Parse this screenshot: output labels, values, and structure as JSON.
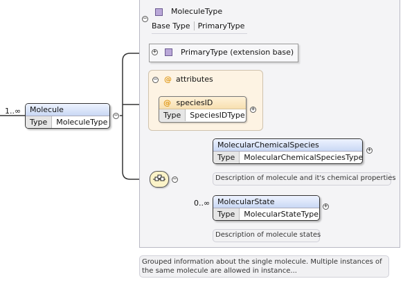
{
  "complex_type": {
    "name": "MoleculeType",
    "base_type_label": "Base Type",
    "base_type_value": "PrimaryType"
  },
  "root_element": {
    "cardinality": "1..∞",
    "name": "Molecule",
    "type_label": "Type",
    "type_value": "MoleculeType"
  },
  "extension": {
    "label": "PrimaryType (extension base)"
  },
  "attributes": {
    "title": "attributes",
    "attr_name": "speciesID",
    "type_label": "Type",
    "type_value": "SpeciesIDType"
  },
  "children": [
    {
      "name": "MolecularChemicalSpecies",
      "type_label": "Type",
      "type_value": "MolecularChemicalSpeciesType",
      "doc": "Description of molecule and it's chemical properties"
    },
    {
      "cardinality": "0..∞",
      "name": "MolecularState",
      "type_label": "Type",
      "type_value": "MolecularStateType",
      "doc": "Description of molecule states"
    }
  ],
  "annotation": "Grouped information about the single molecule. Multiple instances of the same molecule are allowed in instance...",
  "colors": {
    "element_header": "#c9d8f4",
    "attribute_group": "#fdf3e3",
    "type_square": "#b9a7d8"
  }
}
